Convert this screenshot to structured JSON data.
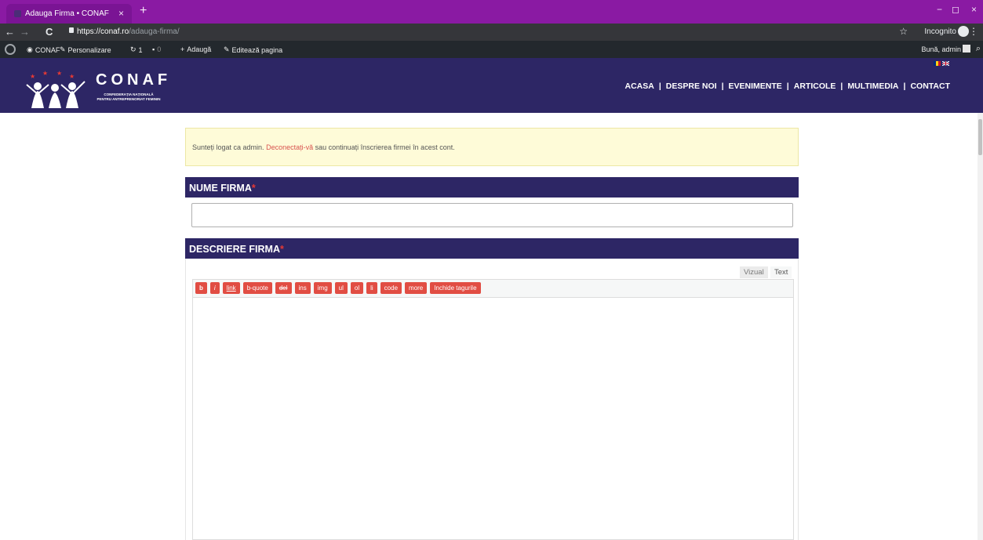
{
  "browser": {
    "tab_title": "Adauga Firma • CONAF",
    "tab_close": "×",
    "new_tab": "+",
    "url_host": "https://conaf.ro",
    "url_path": "/adauga-firma/",
    "incognito_label": "Incognito",
    "window_controls": [
      "−",
      "◻",
      "×"
    ]
  },
  "adminbar": {
    "site": "CONAF",
    "customize": "Personalizare",
    "updates": "1",
    "comments": "0",
    "add_new": "Adaugă",
    "edit_page": "Editează pagina",
    "greeting": "Bună, admin"
  },
  "header": {
    "logo_text": "CONAF",
    "logo_sub_line1": "CONFEDERAȚIA NAȚIONALĂ",
    "logo_sub_line2": "PENTRU ANTREPRENORIAT FEMININ",
    "nav": [
      "ACASA",
      "DESPRE NOI",
      "EVENIMENTE",
      "ARTICOLE",
      "MULTIMEDIA",
      "CONTACT"
    ],
    "nav_separator": "|",
    "colors": {
      "header_bg": "#2d2665",
      "browser_tab_bg": "#8a1aa3",
      "accent_red": "#e14d43"
    }
  },
  "notice": {
    "before": "Sunteți logat ca admin.",
    "link": "Deconectați-vă",
    "after": "sau continuați înscrierea firmei în acest cont."
  },
  "form": {
    "name_label": "NUME FIRMA",
    "required_mark": "*",
    "name_value": "",
    "description_label": "DESCRIERE FIRMA",
    "tab_visual": "Vizual",
    "tab_text": "Text",
    "quicktags": [
      "b",
      "i",
      "link",
      "b-quote",
      "del",
      "ins",
      "img",
      "ul",
      "ol",
      "li",
      "code",
      "more",
      "Inchide tagurile"
    ]
  }
}
